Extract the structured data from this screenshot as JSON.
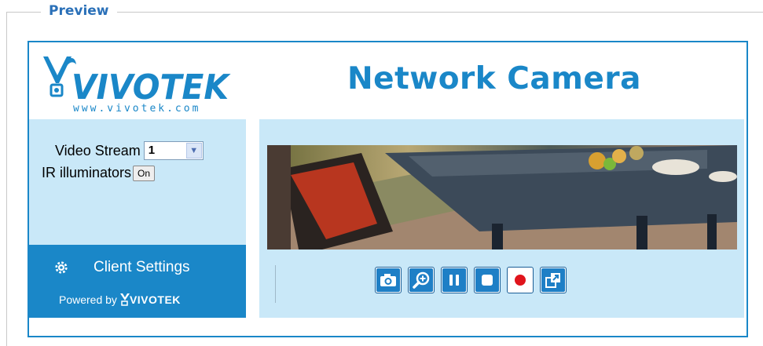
{
  "section": {
    "legend": "Preview"
  },
  "header": {
    "brand": "VIVOTEK",
    "brand_url": "www.vivotek.com",
    "title": "Network Camera"
  },
  "controls": {
    "video_stream_label": "Video Stream",
    "video_stream_value": "1",
    "ir_label": "IR illuminators",
    "ir_button": "On"
  },
  "client": {
    "settings_label": "Client Settings",
    "powered_by": "Powered by",
    "powered_brand": "VIVOTEK"
  },
  "toolbar": {
    "buttons": [
      "snapshot-icon",
      "digital-zoom-icon",
      "pause-icon",
      "stop-icon",
      "record-icon",
      "fullscreen-icon"
    ]
  },
  "colors": {
    "accent": "#1a87c8",
    "panel": "#c9e8f8",
    "legend": "#2a70b8",
    "record": "#e0141c"
  }
}
